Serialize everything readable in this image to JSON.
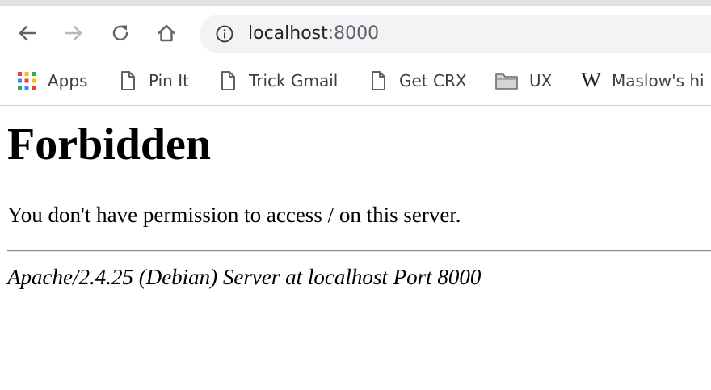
{
  "browser": {
    "address_bar": {
      "host": "localhost",
      "port": ":8000"
    },
    "bookmarks": [
      {
        "label": "Apps",
        "icon": "apps-grid-icon"
      },
      {
        "label": "Pin It",
        "icon": "page-icon"
      },
      {
        "label": "Trick Gmail",
        "icon": "page-icon"
      },
      {
        "label": "Get CRX",
        "icon": "page-icon"
      },
      {
        "label": "UX",
        "icon": "folder-icon"
      },
      {
        "label": "Maslow's hi",
        "icon": "wikipedia-icon",
        "icon_text": "W"
      }
    ]
  },
  "page": {
    "title": "Forbidden",
    "message": "You don't have permission to access / on this server.",
    "server_signature": "Apache/2.4.25 (Debian) Server at localhost Port 8000"
  },
  "colors": {
    "apps_grid": [
      "#ea4335",
      "#fbbc04",
      "#34a853",
      "#4285f4"
    ],
    "forward_disabled": "#b8b8b8",
    "toolbar_icon": "#5f6368"
  }
}
